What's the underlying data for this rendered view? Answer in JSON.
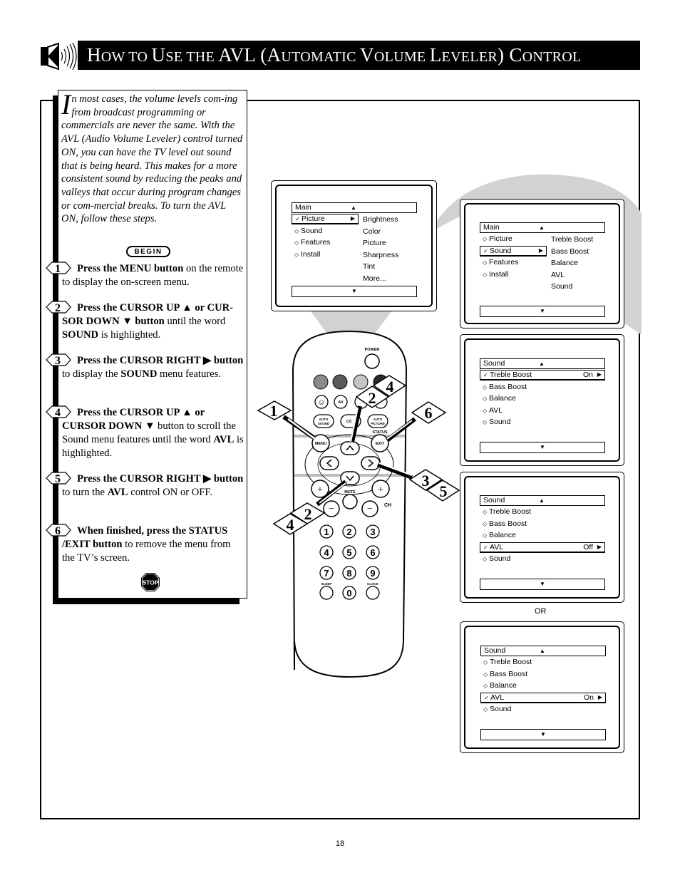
{
  "header": {
    "title_parts": [
      {
        "text": "H",
        "size": "big"
      },
      {
        "text": "OW TO ",
        "size": "sm"
      },
      {
        "text": "U",
        "size": "big"
      },
      {
        "text": "SE THE ",
        "size": "sm"
      },
      {
        "text": "AVL (A",
        "size": "big"
      },
      {
        "text": "UTOMATIC ",
        "size": "sm"
      },
      {
        "text": "V",
        "size": "big"
      },
      {
        "text": "OLUME ",
        "size": "sm"
      },
      {
        "text": "L",
        "size": "big"
      },
      {
        "text": "EVELER",
        "size": "sm"
      },
      {
        "text": ") C",
        "size": "big"
      },
      {
        "text": "ONTROL",
        "size": "sm"
      }
    ],
    "icon": "speaker-icon"
  },
  "intro": {
    "dropcap": "I",
    "text": "n most cases, the volume levels com-ing from broadcast programming or commercials are never the same.  With the AVL (Audio Volume Leveler) control turned ON, you can have the TV level out sound that is being heard.  This makes for a more consistent sound by reducing the peaks and valleys that occur during program changes or com-mercial breaks.  To turn the AVL ON, follow these steps."
  },
  "begin_label": "BEGIN",
  "stop_label": "STOP",
  "steps": [
    {
      "number": "1",
      "bold": "Press the MENU button",
      "rest": " on the remote to display the on-screen menu."
    },
    {
      "number": "2",
      "bold": "Press the CURSOR UP ▲ or CUR-SOR DOWN ▼ button",
      "rest": " until the word ",
      "bold2": "SOUND",
      "rest2": " is highlighted."
    },
    {
      "number": "3",
      "bold": "Press the CURSOR RIGHT ▶ button",
      "rest": " to display the ",
      "bold2": "SOUND",
      "rest2": " menu features."
    },
    {
      "number": "4",
      "bold": "Press the CURSOR UP ▲ or CURSOR DOWN ▼",
      "rest": " button to scroll the Sound menu features until the word ",
      "bold2": "AVL",
      "rest2": " is highlighted."
    },
    {
      "number": "5",
      "bold": "Press the CURSOR RIGHT ▶ button",
      "rest": " to turn the ",
      "bold2": "AVL",
      "rest2": " control ON or OFF."
    },
    {
      "number": "6",
      "bold": "When finished, press the STATUS /EXIT button",
      "rest": " to remove the menu from the TV’s screen."
    }
  ],
  "screens": {
    "main_picture": {
      "header": "Main",
      "items": [
        {
          "label": "Picture",
          "marker": "check",
          "selected": true,
          "arrow": true
        },
        {
          "label": "Sound",
          "marker": "diamond"
        },
        {
          "label": "Features",
          "marker": "diamond"
        },
        {
          "label": "Install",
          "marker": "diamond"
        }
      ],
      "submenu": [
        "Brightness",
        "Color",
        "Picture",
        "Sharpness",
        "Tint",
        "More..."
      ]
    },
    "main_sound": {
      "header": "Main",
      "items": [
        {
          "label": "Picture",
          "marker": "diamond"
        },
        {
          "label": "Sound",
          "marker": "check",
          "selected": true,
          "arrow": true
        },
        {
          "label": "Features",
          "marker": "diamond"
        },
        {
          "label": "Install",
          "marker": "diamond"
        }
      ],
      "submenu": [
        "Treble Boost",
        "Bass Boost",
        "Balance",
        "AVL",
        "Sound"
      ]
    },
    "sound_treble": {
      "header": "Sound",
      "items": [
        {
          "label": "Treble Boost",
          "marker": "check",
          "selected": true,
          "value": "On",
          "arrow": true
        },
        {
          "label": "Bass Boost",
          "marker": "diamond"
        },
        {
          "label": "Balance",
          "marker": "diamond"
        },
        {
          "label": "AVL",
          "marker": "diamond"
        },
        {
          "label": "Sound",
          "marker": "diamond"
        }
      ]
    },
    "sound_avl_off": {
      "header": "Sound",
      "items": [
        {
          "label": "Treble Boost",
          "marker": "diamond"
        },
        {
          "label": "Bass Boost",
          "marker": "diamond"
        },
        {
          "label": "Balance",
          "marker": "diamond"
        },
        {
          "label": "AVL",
          "marker": "check",
          "selected": true,
          "value": "Off",
          "arrow": true
        },
        {
          "label": "Sound",
          "marker": "diamond"
        }
      ]
    },
    "sound_avl_on": {
      "header": "Sound",
      "items": [
        {
          "label": "Treble Boost",
          "marker": "diamond"
        },
        {
          "label": "Bass Boost",
          "marker": "diamond"
        },
        {
          "label": "Balance",
          "marker": "diamond"
        },
        {
          "label": "AVL",
          "marker": "check",
          "selected": true,
          "value": "On",
          "arrow": true
        },
        {
          "label": "Sound",
          "marker": "diamond"
        }
      ]
    }
  },
  "or_label": "OR",
  "remote": {
    "labels": {
      "power": "POWER",
      "av": "AV",
      "auto_sound": "AUTO SOUND",
      "cc": "CC",
      "auto_picture": "AUTO PICTURE",
      "status": "STATUS",
      "menu": "MENU",
      "exit": "EXIT",
      "mute": "MUTE",
      "ch": "CH",
      "sleep": "SLEEP",
      "clock": "CLOCK"
    },
    "digits": [
      "1",
      "2",
      "3",
      "4",
      "5",
      "6",
      "7",
      "8",
      "9",
      "0"
    ],
    "color_buttons": [
      "#8a8a8a",
      "#5a5a5a",
      "#c4c4c4",
      "#2a2a2a"
    ],
    "callouts": {
      "menu": "1",
      "up_down_top": [
        "2",
        "4"
      ],
      "exit": "6",
      "right": [
        "3",
        "5"
      ],
      "down_bottom": [
        "2",
        "4"
      ]
    }
  },
  "page_number": "18"
}
